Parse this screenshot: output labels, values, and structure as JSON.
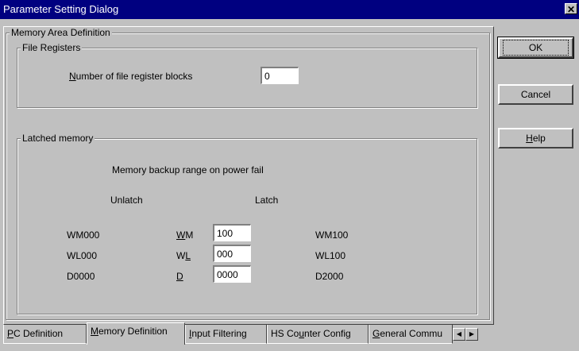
{
  "window": {
    "title": "Parameter Setting Dialog",
    "close_glyph": "✕"
  },
  "memory_area": {
    "title": "Memory Area Definition",
    "file_registers": {
      "title": "File Registers",
      "blocks_label_key": "N",
      "blocks_label_rest": "umber of file register blocks",
      "blocks_value": "0"
    },
    "latched": {
      "title": "Latched memory",
      "caption": "Memory backup range on power fail",
      "unlatch_header": "Unlatch",
      "latch_header": "Latch",
      "rows": [
        {
          "unlatch": "WM000",
          "code_key": "W",
          "code_rest": "M",
          "value": "100",
          "latch": "WM100"
        },
        {
          "unlatch": "WL000",
          "code_pre": "W",
          "code_key": "L",
          "value": "000",
          "latch": "WL100"
        },
        {
          "unlatch": "D0000",
          "code_key": "D",
          "value": "0000",
          "latch": "D2000"
        }
      ]
    }
  },
  "buttons": {
    "ok": "OK",
    "cancel": "Cancel",
    "help_key": "H",
    "help_rest": "elp"
  },
  "tabs": [
    {
      "key": "P",
      "rest": "C Definition"
    },
    {
      "key": "M",
      "rest": "emory Definition"
    },
    {
      "key": "I",
      "rest": "nput Filtering"
    },
    {
      "pre": "HS Co",
      "key": "u",
      "rest": "nter Config"
    },
    {
      "key": "G",
      "rest": "eneral Commu"
    }
  ],
  "tab_scroll": {
    "left_glyph": "◀",
    "right_glyph": "▶"
  }
}
